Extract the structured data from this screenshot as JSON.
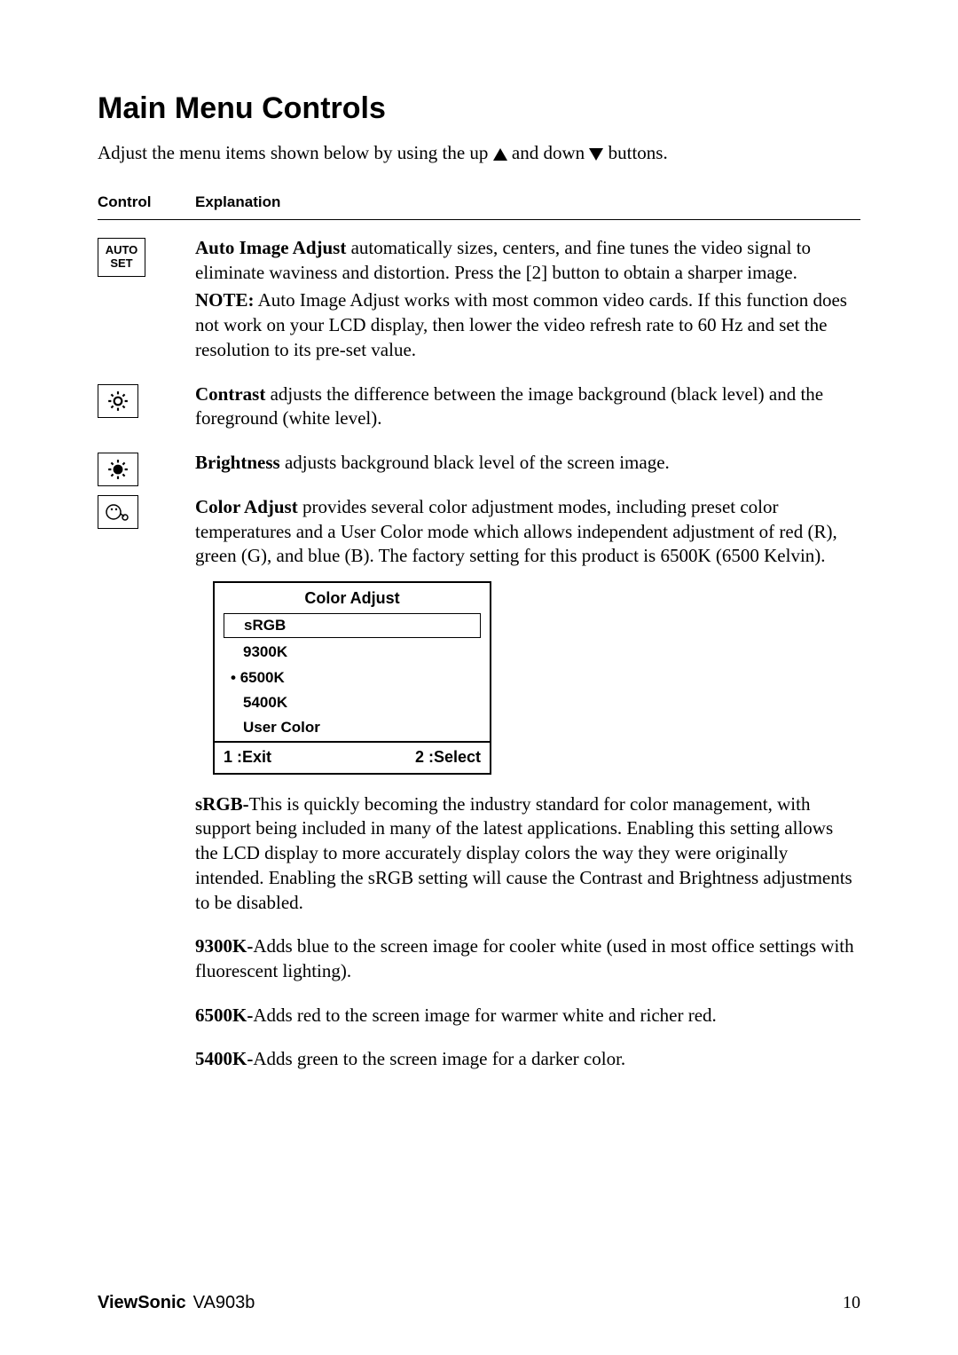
{
  "title": "Main Menu Controls",
  "intro_pre": "Adjust the menu items shown below by using the up ",
  "intro_mid": " and down ",
  "intro_post": " buttons.",
  "header": {
    "control": "Control",
    "explanation": "Explanation"
  },
  "autoset_label": "AUTO\nSET",
  "auto_title": "Auto Image Adjust",
  "auto_text": " automatically sizes, centers, and fine tunes the video signal to eliminate waviness and distortion. Press the [2] button to obtain a sharper image.",
  "auto_note_label": "NOTE:",
  "auto_note_text": " Auto Image Adjust works with most common video cards. If this function does not work on your LCD display, then lower the video refresh rate to 60 Hz and set the resolution to its pre-set value.",
  "contrast_title": "Contrast",
  "contrast_text": " adjusts the difference between the image background  (black level) and the foreground (white level).",
  "brightness_title": "Brightness",
  "brightness_text": " adjusts background black level of the screen image.",
  "color_title": "Color Adjust",
  "color_text": " provides several color adjustment modes, including preset color temperatures and a User Color mode which allows independent adjustment of red (R), green (G), and blue (B). The factory setting for this product is 6500K (6500 Kelvin).",
  "osd": {
    "title": "Color Adjust",
    "items": [
      "sRGB",
      "9300K",
      "6500K",
      "5400K",
      "User Color"
    ],
    "foot_left": "1 :Exit",
    "foot_right": "2 :Select"
  },
  "srgb_title": "sRGB-",
  "srgb_text": "This is quickly becoming the industry standard for color management, with support being included in many of the latest applications. Enabling this setting allows the LCD display to more accurately display colors the way they were originally intended. Enabling the sRGB setting will cause the Contrast and Brightness adjustments to be disabled.",
  "k9300_title": "9300K-",
  "k9300_text": "Adds blue to the screen image for cooler white (used in most office settings with fluorescent lighting).",
  "k6500_title": "6500K-",
  "k6500_text": "Adds red to the screen image for warmer white and richer red.",
  "k5400_title": "5400K-",
  "k5400_text": "Adds green to the screen image for a darker color.",
  "footer": {
    "brand": "ViewSonic",
    "model": "VA903b",
    "page": "10"
  }
}
